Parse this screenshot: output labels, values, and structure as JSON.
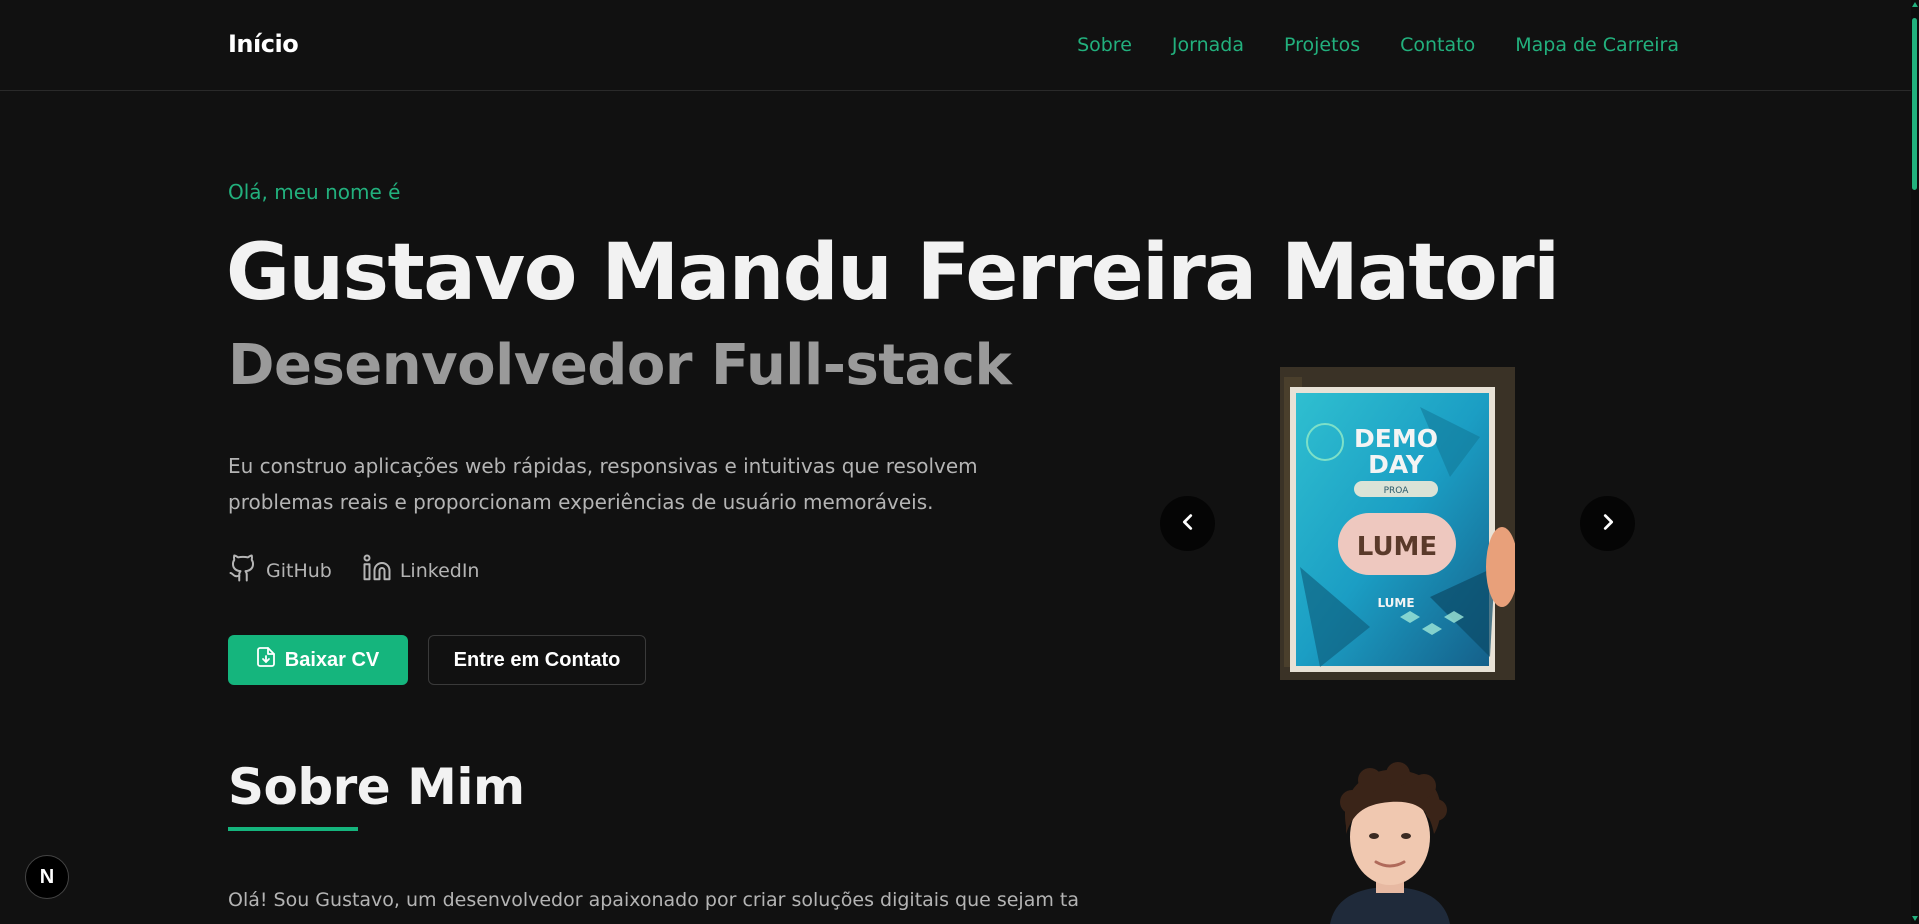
{
  "header": {
    "brand": "Início",
    "nav": [
      {
        "label": "Sobre"
      },
      {
        "label": "Jornada"
      },
      {
        "label": "Projetos"
      },
      {
        "label": "Contato"
      },
      {
        "label": "Mapa de Carreira"
      }
    ]
  },
  "hero": {
    "greeting": "Olá, meu nome é",
    "name": "Gustavo Mandu Ferreira Matori",
    "role": "Desenvolvedor Full-stack",
    "description": "Eu construo aplicações web rápidas, responsivas e intuitivas que resolvem problemas reais e proporcionam experiências de usuário memoráveis.",
    "socials": [
      {
        "label": "GitHub",
        "icon": "github-icon"
      },
      {
        "label": "LinkedIn",
        "icon": "linkedin-icon"
      }
    ],
    "primary_button": "Baixar CV",
    "secondary_button": "Entre em Contato"
  },
  "carousel": {
    "poster_title_1": "DEMO",
    "poster_title_2": "DAY",
    "poster_tag": "PROA",
    "poster_logo": "LUME",
    "poster_caption": "LUME"
  },
  "about": {
    "title": "Sobre Mim",
    "text": "Olá! Sou Gustavo, um desenvolvedor apaixonado por criar soluções digitais que sejam tanto"
  },
  "dev_badge": "N",
  "colors": {
    "accent": "#15b57d",
    "background": "#111111",
    "nav_link": "#22b07d"
  }
}
